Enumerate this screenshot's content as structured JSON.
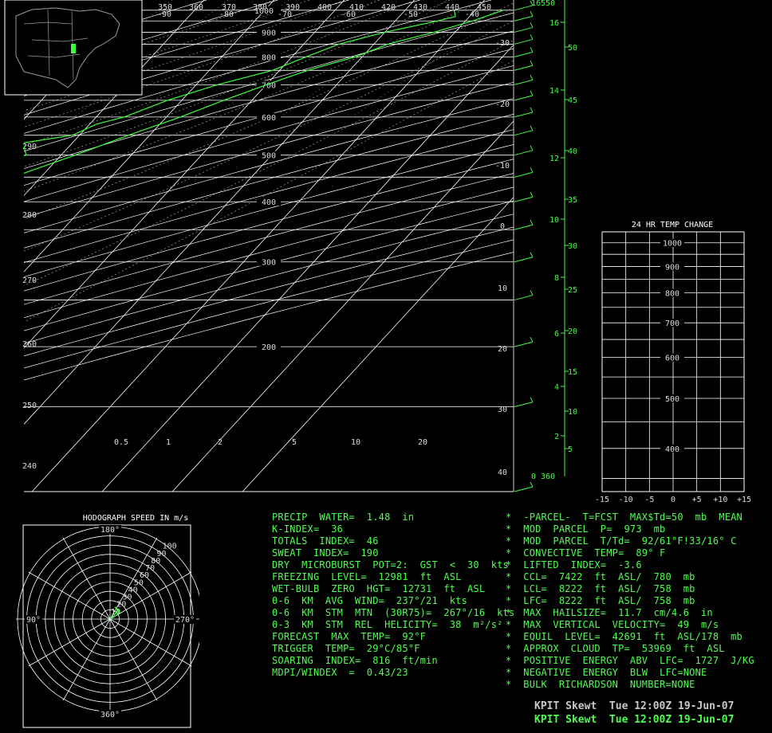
{
  "chart_data": [
    {
      "type": "line",
      "name": "skew-t",
      "pressure_levels": [
        1000,
        900,
        800,
        700,
        600,
        500,
        400,
        300,
        200
      ],
      "isotherm_labels": [
        -90,
        -80,
        -70,
        -60,
        -50,
        -40,
        -30,
        -20,
        -10,
        0,
        10,
        20,
        30,
        40
      ],
      "theta_labels": [
        350,
        360,
        370,
        380,
        390,
        400,
        410,
        420,
        430,
        440,
        450
      ],
      "left_axis_labels": [
        290,
        280,
        270,
        260,
        250,
        240
      ],
      "mixing_ratio_labels": [
        "0.5",
        "1",
        "2",
        "5",
        "10",
        "20"
      ],
      "km_labels": [
        16,
        14,
        12,
        10,
        8,
        6,
        4,
        2,
        "0 360"
      ],
      "kft_labels": [
        50,
        45,
        40,
        35,
        30,
        25,
        20,
        15,
        10,
        5
      ],
      "top_height_label": "16550",
      "series": [
        {
          "role": "temperature",
          "points": [
            [
              1000,
              24
            ],
            [
              950,
              21
            ],
            [
              900,
              17
            ],
            [
              850,
              12
            ],
            [
              800,
              9
            ],
            [
              750,
              4
            ],
            [
              700,
              0
            ],
            [
              650,
              -4
            ],
            [
              600,
              -8
            ],
            [
              550,
              -13
            ],
            [
              500,
              -18
            ],
            [
              450,
              -24
            ],
            [
              400,
              -30
            ],
            [
              350,
              -38
            ],
            [
              300,
              -45
            ],
            [
              250,
              -52
            ],
            [
              200,
              -56
            ],
            [
              150,
              -55
            ],
            [
              110,
              -60
            ]
          ]
        },
        {
          "role": "dewpoint",
          "points": [
            [
              1000,
              17
            ],
            [
              970,
              18
            ],
            [
              950,
              16
            ],
            [
              900,
              10
            ],
            [
              850,
              5
            ],
            [
              800,
              2
            ],
            [
              750,
              -1
            ],
            [
              700,
              -7
            ],
            [
              650,
              -12
            ],
            [
              600,
              -16
            ],
            [
              580,
              -19
            ],
            [
              550,
              -21
            ],
            [
              530,
              -27
            ],
            [
              500,
              -25
            ],
            [
              470,
              -31
            ],
            [
              430,
              -37
            ],
            [
              400,
              -40
            ],
            [
              380,
              -46
            ],
            [
              350,
              -48
            ],
            [
              330,
              -52
            ],
            [
              300,
              -55
            ]
          ]
        }
      ],
      "wind_barbs_mb": [
        1000,
        950,
        900,
        850,
        800,
        750,
        700,
        650,
        600,
        550,
        500,
        450,
        400,
        350,
        300,
        250,
        200,
        150,
        100
      ]
    },
    {
      "type": "line",
      "name": "24hr-temp-change",
      "title": "24 HR TEMP CHANGE",
      "x_ticks": [
        "-15",
        "-10",
        "-5",
        "0",
        "+5",
        "+10",
        "+15"
      ],
      "pressure_labels": [
        400,
        500,
        600,
        700,
        800,
        900,
        1000
      ]
    },
    {
      "type": "scatter",
      "name": "hodograph",
      "title": "HODOGRAPH SPEED IN m/s",
      "direction_labels": [
        "180°",
        "90°",
        "270°",
        "360°"
      ],
      "ring_labels": [
        10,
        20,
        30,
        40,
        50,
        60,
        70,
        80,
        90,
        100
      ]
    }
  ],
  "indices_left": [
    "PRECIP  WATER=  1.48  in",
    "K-INDEX=  36",
    "TOTALS  INDEX=  46",
    "SWEAT  INDEX=  190",
    "DRY  MICROBURST  POT=2:  GST  <  30  kts",
    "FREEZING  LEVEL=  12981  ft  ASL",
    "WET-BULB  ZERO  HGT=  12731  ft  ASL",
    "0-6  KM  AVG  WIND=  237°/21  kts",
    "0-6  KM  STM  MTN  (30R75)=  267°/16  kts",
    "0-3  KM  STM  REL  HELICITY=  38  m²/s²",
    "FORECAST  MAX  TEMP=  92°F",
    "TRIGGER  TEMP=  29°C/85°F",
    "SOARING  INDEX=  816  ft/min",
    "MDPI/WINDEX  =  0.43/23"
  ],
  "indices_right": [
    "*  -PARCEL-  T=FCST  MAX$Td=50  mb  MEAN",
    "*  MOD  PARCEL  P=  973  mb",
    "*  MOD  PARCEL  T/Td=  92/61°F!33/16° C",
    "*  CONVECTIVE  TEMP=  89° F",
    "*  LIFTED  INDEX=  -3.6",
    "*  CCL=  7422  ft  ASL/  780  mb",
    "*  LCL=  8222  ft  ASL/  758  mb",
    "*  LFC=  8222  ft  ASL/  758  mb",
    "*  MAX  HAILSIZE=  11.7  cm/4.6  in",
    "*  MAX  VERTICAL  VELOCITY=  49  m/s",
    "*  EQUIL  LEVEL=  42691  ft  ASL/178  mb",
    "*  APPROX  CLOUD  TP=  53969  ft  ASL",
    "*  POSITIVE  ENERGY  ABV  LFC=  1727  J/KG",
    "*  NEGATIVE  ENERGY  BLW  LFC=NONE",
    "*  BULK  RICHARDSON  NUMBER=NONE"
  ],
  "footer": {
    "line1": "KPIT Skewt  Tue 12:00Z 19-Jun-07",
    "line2": "KPIT Skewt  Tue 12:00Z 19-Jun-07"
  },
  "colors": {
    "profile": "#3dff3d",
    "grid": "#ffffff",
    "dashed": "#aaaaaa",
    "text_green": "#4dff4d"
  }
}
